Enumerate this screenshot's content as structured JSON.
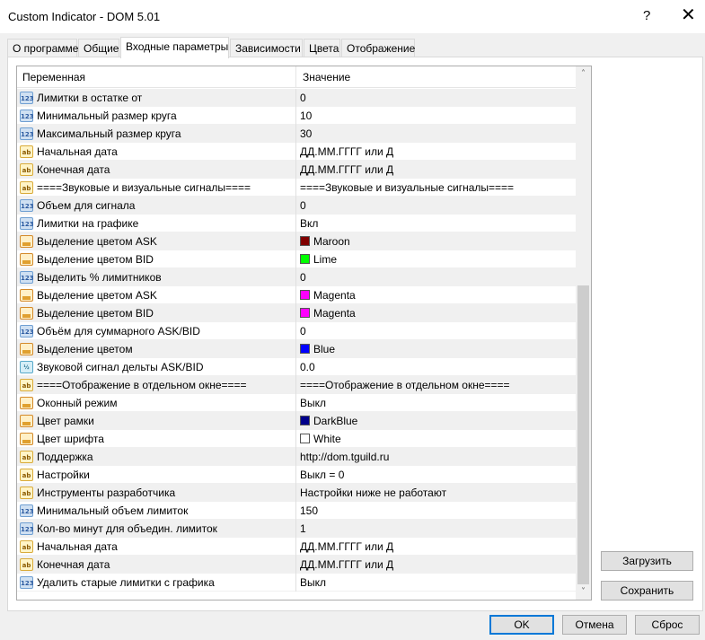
{
  "window": {
    "title": "Custom Indicator - DOM 5.01",
    "help_label": "?",
    "close_label": "✕"
  },
  "tabs": [
    {
      "label": "О программе"
    },
    {
      "label": "Общие"
    },
    {
      "label": "Входные параметры"
    },
    {
      "label": "Зависимости"
    },
    {
      "label": "Цвета"
    },
    {
      "label": "Отображение"
    }
  ],
  "active_tab": "Входные параметры",
  "grid": {
    "headers": {
      "variable": "Переменная",
      "value": "Значение"
    },
    "rows": [
      {
        "icon": "int-icon",
        "icon_text": "123",
        "name": "Лимитки в остатке от",
        "value": "0"
      },
      {
        "icon": "int-icon",
        "icon_text": "123",
        "name": "Минимальный размер круга",
        "value": "10"
      },
      {
        "icon": "int-icon",
        "icon_text": "123",
        "name": "Максимальный размер круга",
        "value": "30"
      },
      {
        "icon": "string-icon",
        "icon_text": "ab",
        "name": "Начальная дата",
        "value": "ДД.ММ.ГГГГ или Д"
      },
      {
        "icon": "string-icon",
        "icon_text": "ab",
        "name": "Конечная дата",
        "value": "ДД.ММ.ГГГГ или Д"
      },
      {
        "icon": "string-icon",
        "icon_text": "ab",
        "name": "====Звуковые и визуальные сигналы====",
        "value": "====Звуковые и визуальные сигналы===="
      },
      {
        "icon": "int-icon",
        "icon_text": "123",
        "name": "Объем для сигнала",
        "value": "0"
      },
      {
        "icon": "int-icon",
        "icon_text": "123",
        "name": "Лимитки на графике",
        "value": "Вкл"
      },
      {
        "icon": "color-icon",
        "icon_text": "",
        "name": "Выделение цветом ASK",
        "value": "Maroon",
        "swatch": "#800000"
      },
      {
        "icon": "color-icon",
        "icon_text": "",
        "name": "Выделение цветом BID",
        "value": "Lime",
        "swatch": "#00ff00"
      },
      {
        "icon": "int-icon",
        "icon_text": "123",
        "name": "Выделить % лимитников",
        "value": "0"
      },
      {
        "icon": "color-icon",
        "icon_text": "",
        "name": "Выделение цветом ASK",
        "value": "Magenta",
        "swatch": "#ff00ff"
      },
      {
        "icon": "color-icon",
        "icon_text": "",
        "name": "Выделение цветом BID",
        "value": "Magenta",
        "swatch": "#ff00ff"
      },
      {
        "icon": "int-icon",
        "icon_text": "123",
        "name": "Объём для суммарного ASK/BID",
        "value": "0"
      },
      {
        "icon": "color-icon",
        "icon_text": "",
        "name": "Выделение цветом",
        "value": "Blue",
        "swatch": "#0000ff"
      },
      {
        "icon": "double-icon",
        "icon_text": "½",
        "name": "Звуковой сигнал дельты ASK/BID",
        "value": "0.0"
      },
      {
        "icon": "string-icon",
        "icon_text": "ab",
        "name": "====Отображение в отдельном окне====",
        "value": "====Отображение в отдельном окне===="
      },
      {
        "icon": "color-icon",
        "icon_text": "",
        "name": "Оконный режим",
        "value": "Выкл"
      },
      {
        "icon": "color-icon",
        "icon_text": "",
        "name": "Цвет рамки",
        "value": "DarkBlue",
        "swatch": "#00008b"
      },
      {
        "icon": "color-icon",
        "icon_text": "",
        "name": "Цвет шрифта",
        "value": "White",
        "swatch": "#ffffff"
      },
      {
        "icon": "string-icon",
        "icon_text": "ab",
        "name": "Поддержка",
        "value": "http://dom.tguild.ru"
      },
      {
        "icon": "string-icon",
        "icon_text": "ab",
        "name": "Настройки",
        "value": "Выкл = 0"
      },
      {
        "icon": "string-icon",
        "icon_text": "ab",
        "name": "Инструменты разработчика",
        "value": "Настройки ниже не работают"
      },
      {
        "icon": "int-icon",
        "icon_text": "123",
        "name": "Минимальный объем лимиток",
        "value": "150"
      },
      {
        "icon": "int-icon",
        "icon_text": "123",
        "name": "Кол-во минут для объедин. лимиток",
        "value": "1"
      },
      {
        "icon": "string-icon",
        "icon_text": "ab",
        "name": "Начальная дата",
        "value": "ДД.ММ.ГГГГ или Д"
      },
      {
        "icon": "string-icon",
        "icon_text": "ab",
        "name": "Конечная дата",
        "value": "ДД.ММ.ГГГГ или Д"
      },
      {
        "icon": "int-icon",
        "icon_text": "123",
        "name": "Удалить старые лимитки с графика",
        "value": "Выкл"
      }
    ]
  },
  "side_buttons": {
    "load_label": "Загрузить",
    "save_label": "Сохранить"
  },
  "footer_buttons": {
    "ok_label": "OK",
    "cancel_label": "Отмена",
    "reset_label": "Сброс"
  },
  "scrollbar": {
    "up_glyph": "˄",
    "down_glyph": "˅"
  }
}
